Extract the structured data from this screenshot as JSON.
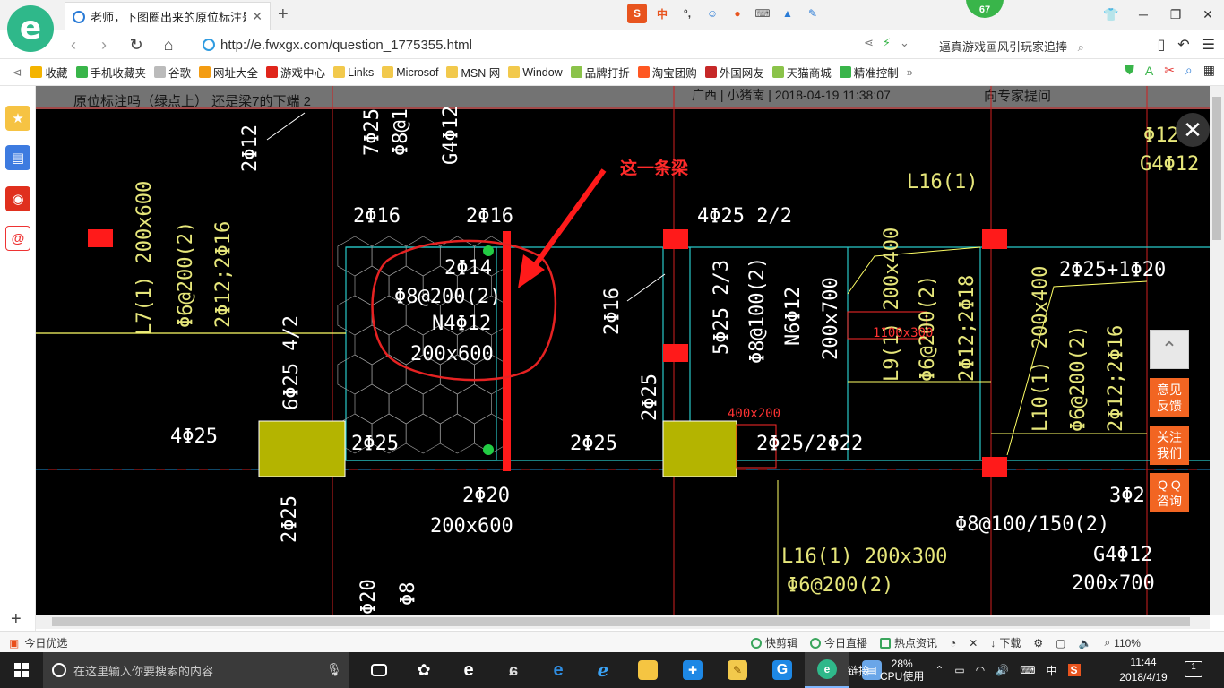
{
  "browser": {
    "tab": {
      "title": "老师，下图圈出来的原位标注是"
    },
    "weather_badge": "67",
    "url": "http://e.fwxgx.com/question_1775355.html",
    "search_hint": "逼真游戏画风引玩家追捧",
    "bookmarks": [
      {
        "label": "收藏",
        "color": "#f4b400"
      },
      {
        "label": "手机收藏夹",
        "color": "#39b54a"
      },
      {
        "label": "谷歌",
        "color": "#bbbbbb"
      },
      {
        "label": "网址大全",
        "color": "#f39c12"
      },
      {
        "label": "游戏中心",
        "color": "#e0251b"
      },
      {
        "label": "Links",
        "color": "#f2c94c"
      },
      {
        "label": "Microsof",
        "color": "#f2c94c"
      },
      {
        "label": "MSN 网",
        "color": "#f2c94c"
      },
      {
        "label": "Window",
        "color": "#f2c94c"
      },
      {
        "label": "品牌打折",
        "color": "#8bc34a"
      },
      {
        "label": "淘宝团购",
        "color": "#ff5722"
      },
      {
        "label": "外国网友",
        "color": "#c62828"
      },
      {
        "label": "天猫商城",
        "color": "#8bc34a"
      },
      {
        "label": "精准控制",
        "color": "#39b54a"
      }
    ]
  },
  "page": {
    "under_text_1": "原位标注吗（绿点上）  还是梁7的下端 2",
    "under_meta": "广西 | 小猪南 | 2018-04-19 11:38:07",
    "under_side": "向专家提问",
    "annotation": "这一条梁",
    "float_buttons": [
      "意见\n反馈",
      "关注\n我们",
      "Q Q\n咨询"
    ]
  },
  "cad_labels": {
    "t1": "2Φ12",
    "t2": "7Φ25",
    "t3": "Φ8@1",
    "t4": "G4Φ12",
    "t5": "L7(1) 200x600",
    "t6": "Φ6@200(2)",
    "t7": "2Φ12;2Φ16",
    "t8": "2Φ16",
    "t9": "2Φ16",
    "t10": "4Φ25 2/2",
    "t11": "L16(1)",
    "t12": "2Φ14",
    "t13": "Φ8@200(2)",
    "t14": "N4Φ12",
    "t15": "200x600",
    "t16": "2Φ16",
    "t17": "5Φ25 2/3",
    "t18": "Φ8@100(2)",
    "t19": "N6Φ12",
    "t20": "200x700",
    "t21": "L9(1) 200x400",
    "t22": "Φ6@200(2)",
    "t23": "2Φ12;2Φ18",
    "t24": "1100x300",
    "t25": "2Φ25+1Φ20",
    "t26": "L10(1) 200x400",
    "t27": "Φ6@200(2)",
    "t28": "2Φ12;2Φ16",
    "t29": "6Φ25 4/2",
    "t30": "4Φ25",
    "t31": "2Φ25",
    "t32": "2Φ25",
    "t33": "2Φ25/2Φ22",
    "t34": "400x200",
    "t35": "2Φ25",
    "t36": "2Φ20",
    "t37": "200x600",
    "t38": "2Φ25",
    "t39": "3Φ2",
    "t40": "Φ8@100/150(2)",
    "t41": "G4Φ12",
    "t42": "200x700",
    "t43": "L16(1) 200x300",
    "t44": "Φ6@200(2)",
    "t45": "Φ12",
    "t46": "Φ8",
    "t47": "G4Φ12",
    "t48": "Φ20"
  },
  "statusbar": {
    "left": "今日优选",
    "items": [
      "快剪辑",
      "今日直播",
      "热点资讯",
      "下载"
    ],
    "zoom": "110%"
  },
  "taskbar": {
    "search_placeholder": "在这里输入你要搜索的内容",
    "tray_link": "链接",
    "cpu_percent": "28%",
    "cpu_label": "CPU使用",
    "ime": "中",
    "time": "11:44",
    "date": "2018/4/19",
    "notifications": "1"
  }
}
